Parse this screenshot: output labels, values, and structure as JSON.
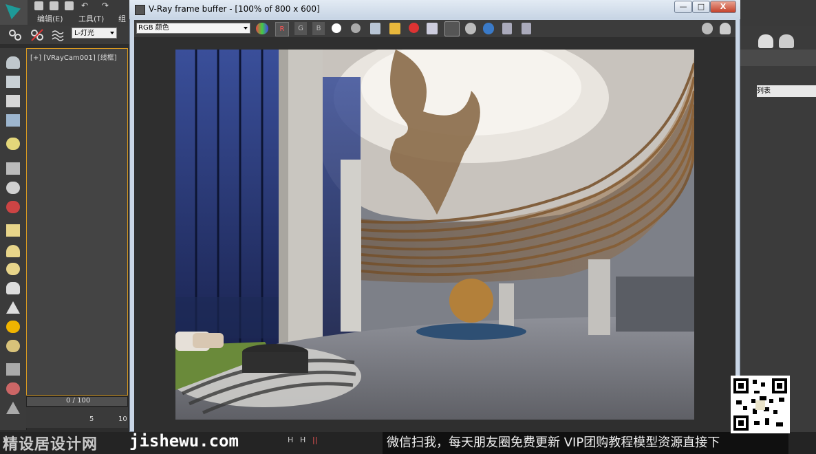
{
  "max": {
    "menu": [
      "编辑(E)",
      "工具(T)",
      "组"
    ],
    "selection_set": "L-灯光",
    "viewport_label": "[+] [VRayCam001] [线框]",
    "time_slider": "0 / 100",
    "track_ticks": [
      "5",
      "10"
    ],
    "right_panel_field": "列表"
  },
  "vfb": {
    "title": "V-Ray frame buffer - [100% of 800 x 600]",
    "channel": "RGB 颜色",
    "rgb_buttons": [
      "R",
      "G",
      "B"
    ],
    "min_symbol": "—",
    "max_symbol": "□",
    "close_symbol": "X",
    "icons": [
      "color-swatch-icon",
      "white-dot-icon",
      "grey-dot-icon",
      "save-icon",
      "open-icon",
      "clear-icon",
      "render-icon",
      "region-icon",
      "lens-icon",
      "history-icon",
      "compare-a-icon",
      "compare-b-icon",
      "settings-icon",
      "teapot-icon"
    ]
  },
  "overlay": {
    "watermark_site": "jishewu.com",
    "watermark_left": "精设居设计网",
    "banner": "微信扫我，每天朋友圈免费更新 VIP团购教程模型资源直接下",
    "status_icons": [
      "H",
      "H",
      "||"
    ]
  },
  "colors": {
    "vray_title": "#c7d4e4",
    "vfb_bg": "#2f2f2f",
    "viewport_border": "#d79921",
    "close_red": "#c4412a"
  }
}
